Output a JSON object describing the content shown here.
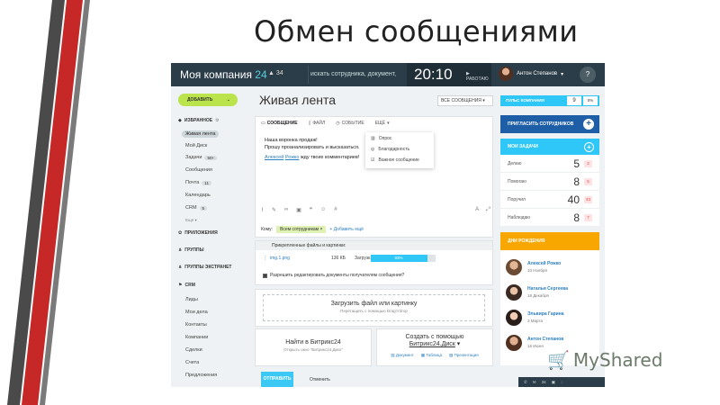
{
  "slide": {
    "title": "Обмен сообщениями"
  },
  "topbar": {
    "company": "Моя компания",
    "company_num": "24",
    "notif_count": "34",
    "search_placeholder": "искать сотрудника, документ,",
    "time": "20:10",
    "work_status": "РАБОТАЮ",
    "user_name": "Антон Степанов",
    "help": "?"
  },
  "sidebar": {
    "add_button": "ДОБАВИТЬ",
    "favorites": "ИЗБРАННОЕ",
    "items": [
      {
        "label": "Живая лента"
      },
      {
        "label": "Мой Диск"
      },
      {
        "label": "Задачи",
        "badge": "50+"
      },
      {
        "label": "Сообщения"
      },
      {
        "label": "Почта",
        "badge": "11"
      },
      {
        "label": "Календарь"
      },
      {
        "label": "CRM",
        "badge": "5"
      }
    ],
    "more": "Ещё",
    "sections": [
      "ПРИЛОЖЕНИЯ",
      "ГРУППЫ",
      "ГРУППЫ ЭКСТРАНЕТ",
      "CRM"
    ],
    "crm_items": [
      "Лиды",
      "Мои дела",
      "Контакты",
      "Компании",
      "Сделки",
      "Счета",
      "Предложения"
    ]
  },
  "feed": {
    "title": "Живая лента",
    "all_messages": "ВСЕ СООБЩЕНИЯ",
    "tabs": [
      "СООБЩЕНИЕ",
      "ФАЙЛ",
      "СОБЫТИЕ",
      "ЕЩЁ"
    ],
    "text_line1": "Наша воронка продаж!",
    "text_line2": "Прошу проанализировать и высказаться.",
    "mention1": "Алексей",
    "mention2": "Рожко",
    "text_line3_rest": "жду твоих комментариев!",
    "dropdown": [
      "Опрос",
      "Благодарность",
      "Важное сообщение"
    ],
    "to_label": "Кому:",
    "to_chip": "Всем сотрудникам",
    "add_more": "+ Добавить ещё"
  },
  "attach": {
    "header": "Прикрепленные файлы и картинки:",
    "file_name": "img.1.png",
    "file_size": "136 КБ",
    "loading_label": "Загрузка",
    "progress_text": "93%",
    "progress": 93,
    "allow_edit": "Разрешить редактировать документы получателям сообщения?"
  },
  "upload": {
    "title": "Загрузить файл или картинку",
    "sub": "Перетащить с помощью Drag'n'drop"
  },
  "find": {
    "title": "Найти в Битрикс24",
    "sub": "Открыть окно \"Битрикс24.Диск\""
  },
  "create": {
    "title_line1": "Создать с помощью",
    "title_line2": "Битрикс24.Диск",
    "items": [
      "Документ",
      "Таблица",
      "Презентация"
    ]
  },
  "actions": {
    "send": "ОТПРАВИТЬ",
    "cancel": "Отменить"
  },
  "right": {
    "pulse_label": "ПУЛЬС КОМПАНИИ",
    "pulse_value": "9",
    "pulse_pct": "0%",
    "invite": "ПРИГЛАСИТЬ СОТРУДНИКОВ",
    "tasks_title": "МОИ ЗАДАЧИ",
    "tasks": [
      {
        "label": "Делаю",
        "count": "5",
        "new": "2"
      },
      {
        "label": "Помогаю",
        "count": "8",
        "new": "5"
      },
      {
        "label": "Поручил",
        "count": "40",
        "new": "43"
      },
      {
        "label": "Наблюдаю",
        "count": "8",
        "new": "7"
      }
    ],
    "birthdays_title": "ДНИ РОЖДЕНИЯ",
    "birthdays": [
      {
        "name": "Алексей Рожко",
        "date": "10 Ноября"
      },
      {
        "name": "Наталья Сергеева",
        "date": "18 Декабря"
      },
      {
        "name": "Эльвира Гарина",
        "date": "3 Марта"
      },
      {
        "name": "Антон Степанов",
        "date": "16 Июня"
      }
    ],
    "bottom_count": "34"
  },
  "watermark": "MyShared",
  "colors": {
    "topbar": "#2b3d48",
    "accent_green": "#bbe34b",
    "accent_blue": "#2fc7f7",
    "invite_blue": "#1d5ea6",
    "birthday_orange": "#f7a700",
    "stripe_red": "#c62828",
    "stripe_gray": "#4a4a4a"
  }
}
